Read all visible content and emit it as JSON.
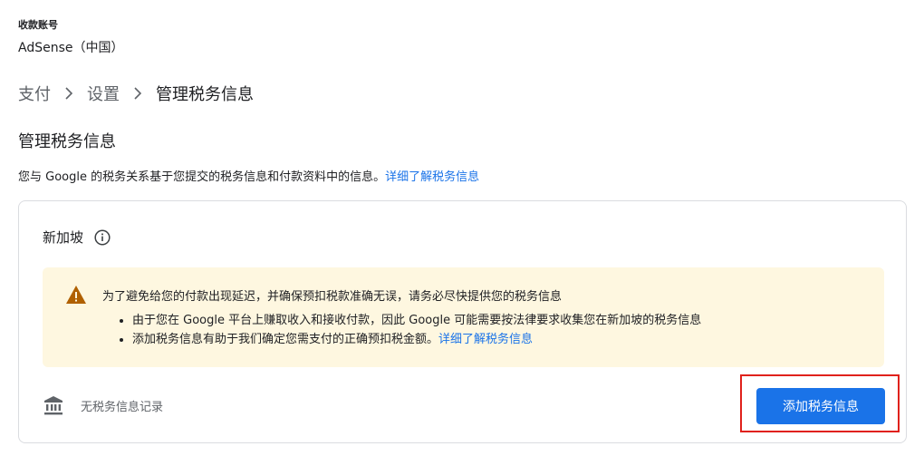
{
  "account": {
    "label": "收款账号",
    "name": "AdSense（中国）"
  },
  "breadcrumb": {
    "items": [
      "支付",
      "设置",
      "管理税务信息"
    ]
  },
  "page": {
    "title": "管理税务信息",
    "intro_text": "您与 Google 的税务关系基于您提交的税务信息和付款资料中的信息。",
    "intro_link": "详细了解税务信息"
  },
  "card": {
    "country": "新加坡",
    "warning": {
      "title": "为了避免给您的付款出现延迟，并确保预扣税款准确无误，请务必尽快提供您的税务信息",
      "bullet1": "由于您在 Google 平台上赚取收入和接收付款，因此 Google 可能需要按法律要求收集您在新加坡的税务信息",
      "bullet2_text": "添加税务信息有助于我们确定您需支付的正确预扣税金额。",
      "bullet2_link": "详细了解税务信息"
    },
    "empty_text": "无税务信息记录",
    "add_button": "添加税务信息"
  },
  "colors": {
    "primary": "#1a73e8",
    "warning_bg": "#fef7e0",
    "warning_icon": "#b06000",
    "highlight": "#e0211b",
    "border": "#dadce0"
  }
}
